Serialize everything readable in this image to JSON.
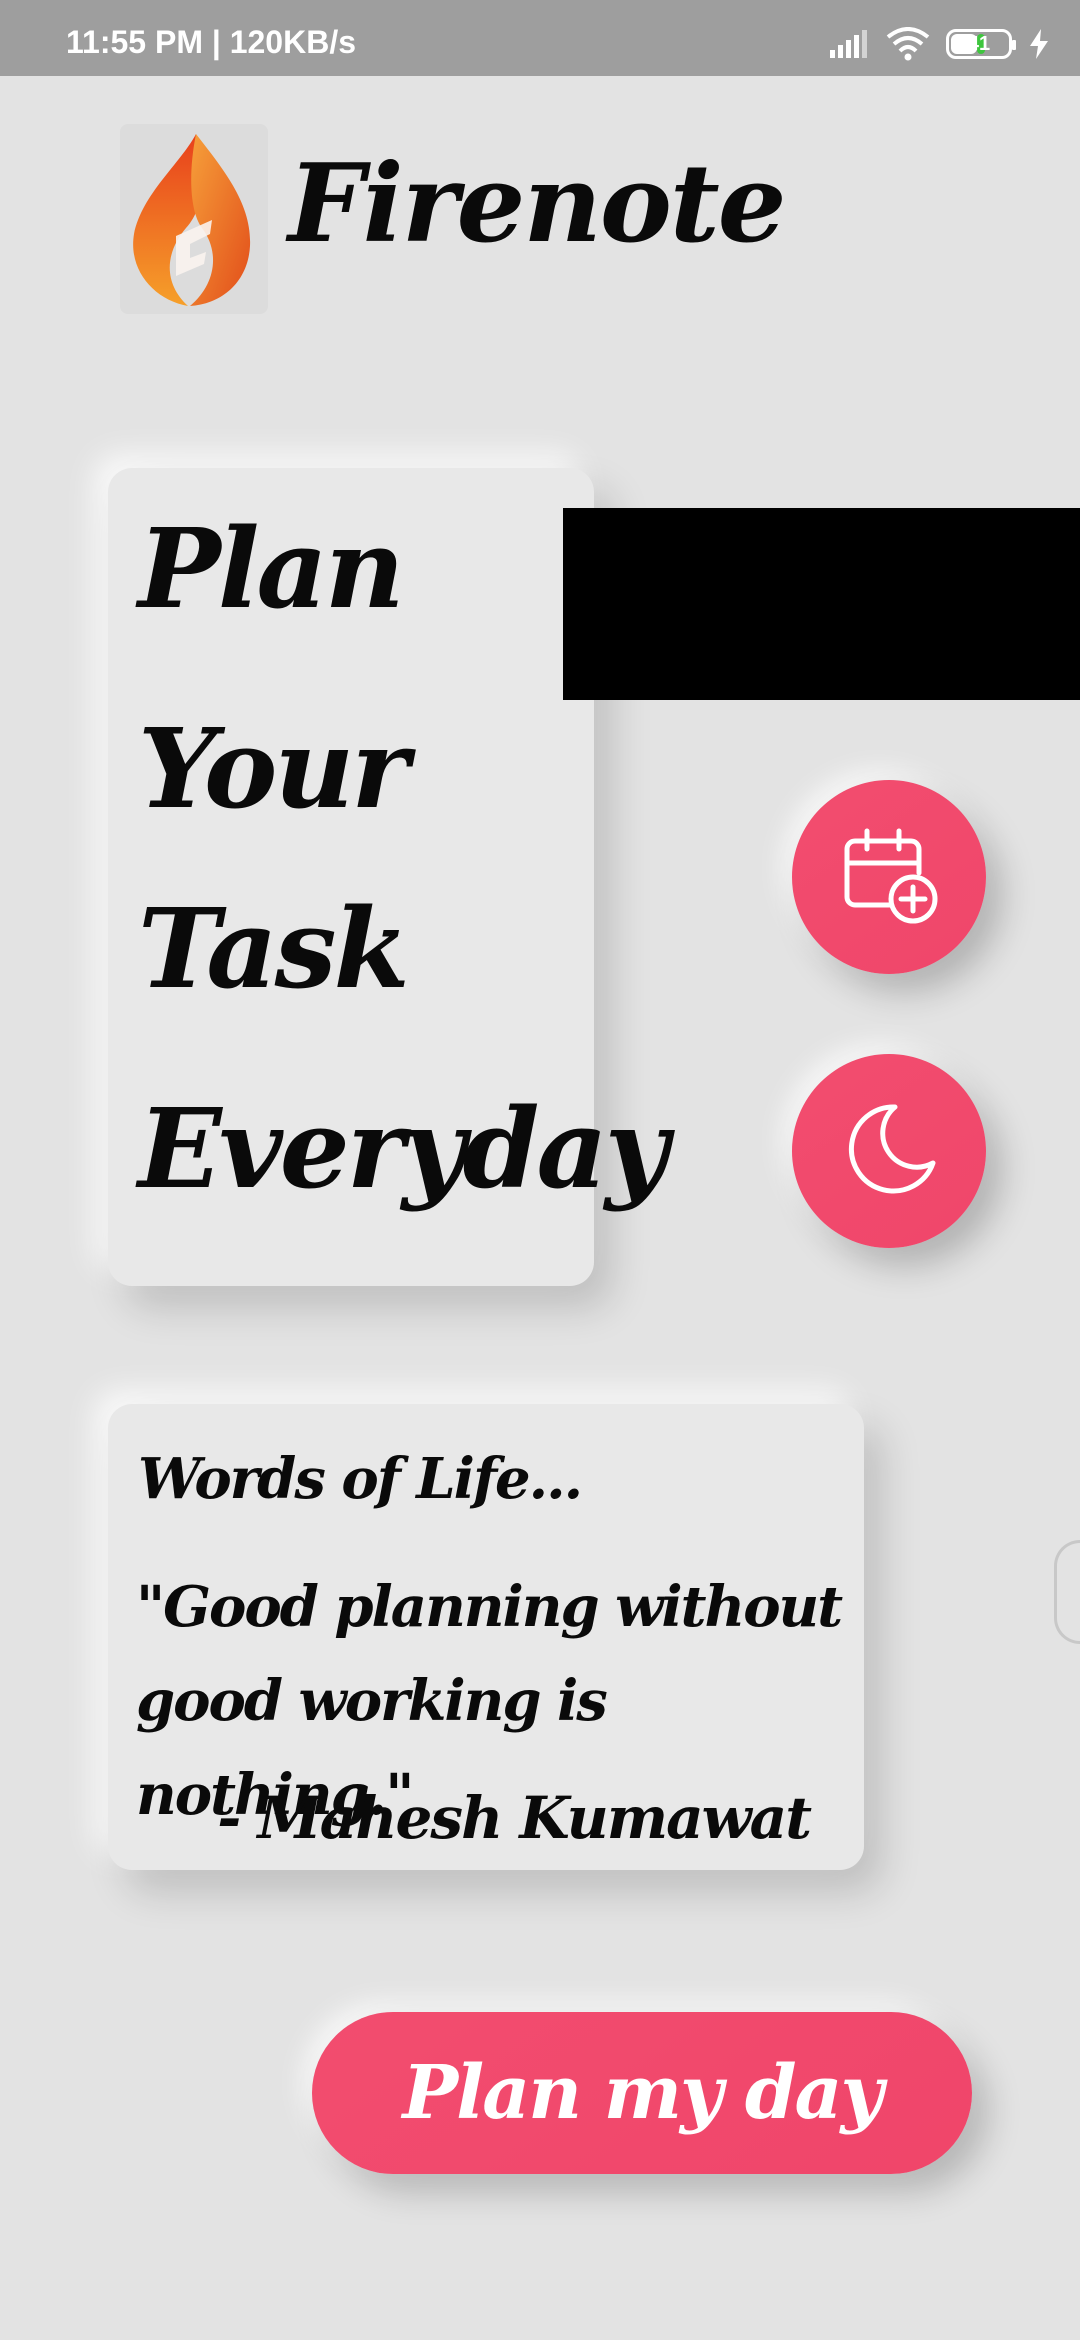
{
  "status_bar": {
    "time_speed": "11:55 PM | 120KB/s",
    "battery_level": "41",
    "icons": [
      "signal-icon",
      "wifi-icon",
      "battery-icon",
      "charging-icon"
    ]
  },
  "header": {
    "app_name": "Firenote",
    "logo_icon": "flame-logo-icon"
  },
  "motto": {
    "words": [
      "Plan",
      "Your",
      "Task",
      "Everyday"
    ]
  },
  "actions": {
    "add_task_icon": "calendar-plus-icon",
    "night_mode_icon": "moon-icon"
  },
  "quote": {
    "heading": "Words of Life...",
    "text": "\"Good planning without good working is nothing.\"",
    "author": "- Mahesh Kumawat"
  },
  "primary_button": {
    "label": "Plan my day"
  },
  "colors": {
    "background": "#e3e3e3",
    "accent": "#f24a6c",
    "status_bar": "#9e9e9e",
    "logo_orange": "#f47a22",
    "logo_red": "#e63b1a"
  }
}
